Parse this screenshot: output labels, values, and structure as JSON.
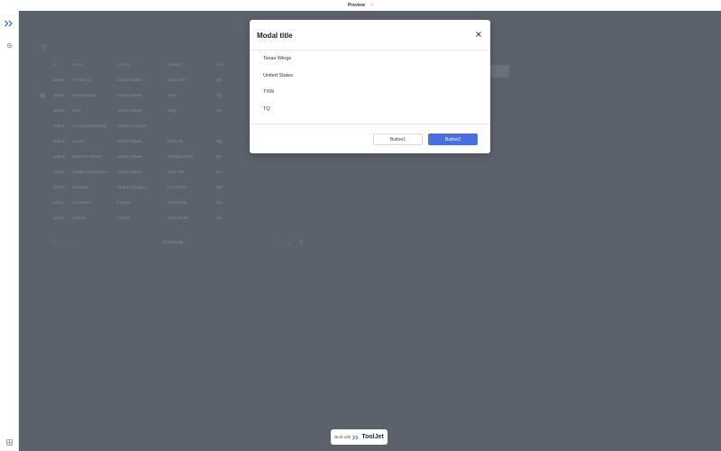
{
  "topbar": {
    "title": "Preview",
    "external_glyph": "↗"
  },
  "sidebar": {
    "logo": "tooljet-logo-icon",
    "items": [
      {
        "icon": "settings-gear-icon"
      }
    ],
    "bottom": {
      "icon": "grid-icon"
    }
  },
  "table": {
    "columns": [
      "id",
      "name",
      "country",
      "callsign",
      "iata"
    ],
    "rows": [
      [
        "airline_",
        "40-Mile Air",
        "United States",
        "MILE-AIR",
        "Q5"
      ],
      [
        "airline_",
        "Texas Wings",
        "United States",
        "TXW",
        "TQ"
      ],
      [
        "airline_",
        "Airlin",
        "United States",
        "airlig",
        "A1"
      ],
      [
        "airline_",
        "All Airlines(Ireland)",
        "United Kingdom",
        "",
        ""
      ],
      [
        "airline_",
        "Locair",
        "United States",
        "LOCAIR",
        "ZQ"
      ],
      [
        "airline_",
        "SeaPort Airlines",
        "United States",
        "SASQUATCH",
        "K5"
      ],
      [
        "airline_",
        "Alaska Central Exp",
        "United States",
        "ACE AIR",
        "KO"
      ],
      [
        "airline_",
        "Astraeus",
        "United Kingdom",
        "FLYSTAR",
        "5W"
      ],
      [
        "airline_",
        "Air Austral",
        "France",
        "REUNION",
        "UU"
      ],
      [
        "airline_",
        "Airlinair",
        "France",
        "AIRLINAIR",
        "A5"
      ]
    ],
    "pager": {
      "records": "10 Records"
    }
  },
  "modal": {
    "title": "Modal title",
    "lines": [
      "Texas Wings",
      "United States",
      "TXW",
      "TQ"
    ],
    "button_secondary": "Button1",
    "button_primary": "Button2"
  },
  "badge": {
    "prefix": "Built with",
    "brand": "ToolJet"
  },
  "colors": {
    "primary": "#4a6fe3",
    "overlay": "#5c626b",
    "brand": "#1a2b5c"
  }
}
